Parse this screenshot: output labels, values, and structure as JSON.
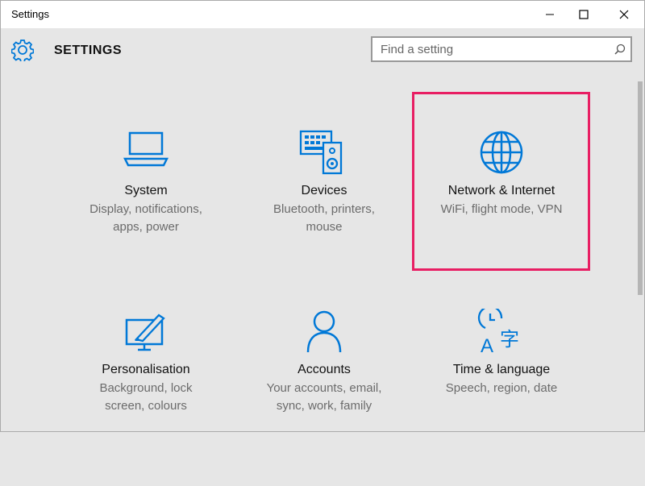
{
  "window": {
    "title": "Settings"
  },
  "header": {
    "title": "SETTINGS",
    "search_placeholder": "Find a setting"
  },
  "colors": {
    "accent": "#0078d7",
    "highlight": "#e81e63"
  },
  "tiles": [
    {
      "name": "System",
      "desc_line1": "Display, notifications,",
      "desc_line2": "apps, power",
      "icon": "laptop-icon"
    },
    {
      "name": "Devices",
      "desc_line1": "Bluetooth, printers,",
      "desc_line2": "mouse",
      "icon": "devices-icon"
    },
    {
      "name": "Network & Internet",
      "desc_line1": "WiFi, flight mode, VPN",
      "desc_line2": "",
      "icon": "globe-icon"
    },
    {
      "name": "Personalisation",
      "desc_line1": "Background, lock",
      "desc_line2": "screen, colours",
      "icon": "personalisation-icon"
    },
    {
      "name": "Accounts",
      "desc_line1": "Your accounts, email,",
      "desc_line2": "sync, work, family",
      "icon": "person-icon"
    },
    {
      "name": "Time & language",
      "desc_line1": "Speech, region, date",
      "desc_line2": "",
      "icon": "time-language-icon"
    }
  ]
}
